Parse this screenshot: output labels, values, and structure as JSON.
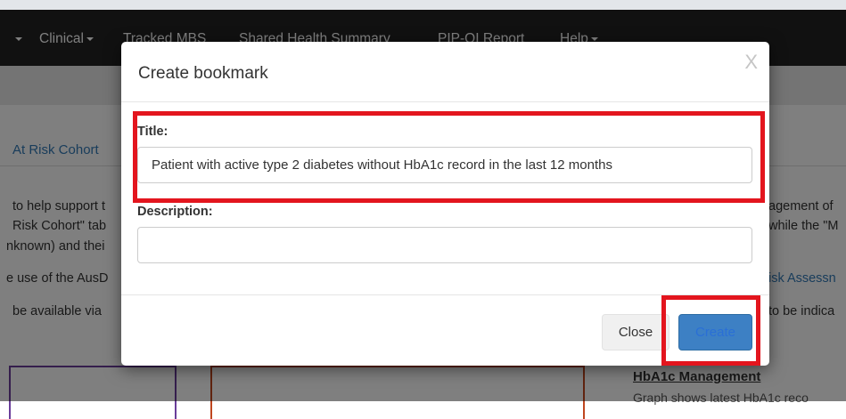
{
  "navbar": {
    "caret_only": "▾",
    "items": [
      {
        "label": "Clinical",
        "dropdown": true
      },
      {
        "label": "Tracked MBS",
        "dropdown": false
      },
      {
        "label": "Shared Health Summary",
        "dropdown": false
      },
      {
        "label": "PIP-QI Report",
        "dropdown": false
      },
      {
        "label": "Help",
        "dropdown": true
      }
    ]
  },
  "background": {
    "tab_label": "At Risk Cohort",
    "left_lines": [
      "to help support t",
      "Risk Cohort\" tab",
      "nknown) and thei",
      "e use of the AusD",
      "be available via "
    ],
    "right_lines": [
      "agement of",
      "while the \"M",
      "isk Assessn",
      "to be indica"
    ],
    "hba1c_title": "HbA1c Management",
    "hba1c_desc": "Graph shows latest HbA1c reco"
  },
  "modal": {
    "title": "Create bookmark",
    "close_glyph": "X",
    "title_label": "Title:",
    "title_value": "Patient with active type 2 diabetes without HbA1c record in the last 12 months",
    "description_label": "Description:",
    "description_value": "",
    "close_button": "Close",
    "create_button": "Create"
  },
  "colors": {
    "navbar": "#222222",
    "highlight": "#e3151e",
    "primary": "#3d80c4",
    "link": "#337ab7"
  }
}
